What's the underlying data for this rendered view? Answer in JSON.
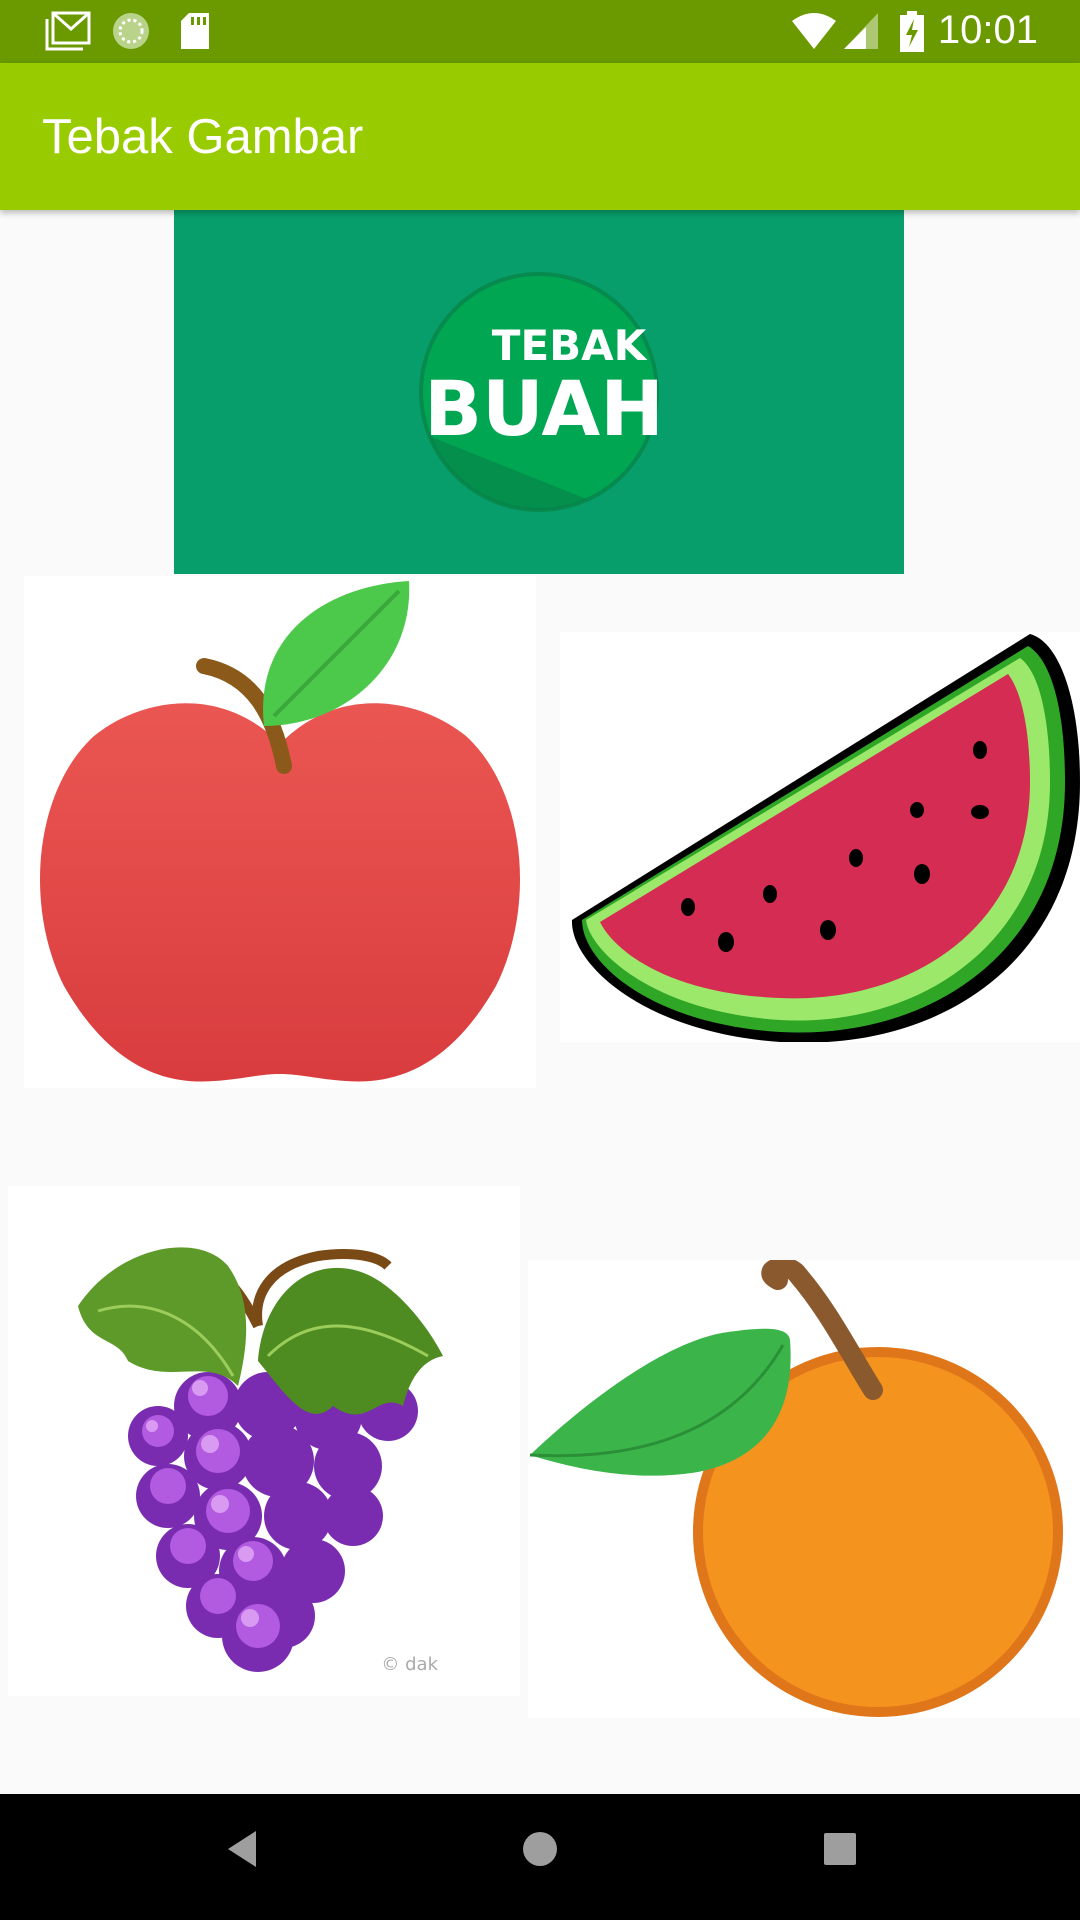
{
  "status_bar": {
    "time": "10:01",
    "icons": [
      "gmail-icon",
      "sync-icon",
      "sd-card-icon",
      "wifi-icon",
      "signal-icon",
      "battery-charging-icon"
    ]
  },
  "app_bar": {
    "title": "Tebak Gambar"
  },
  "banner": {
    "logo_text_top": "TEBAK",
    "logo_text_bottom": "BUAH",
    "background_color": "#089e6c"
  },
  "fruits": [
    {
      "name": "apple-image"
    },
    {
      "name": "watermelon-image"
    },
    {
      "name": "grapes-image",
      "watermark": "© dak"
    },
    {
      "name": "orange-image"
    }
  ],
  "nav_bar": {
    "buttons": [
      "back-icon",
      "home-icon",
      "recents-icon"
    ]
  },
  "colors": {
    "status_bar": "#6a9a00",
    "app_bar": "#99cc00",
    "page_bg": "#fafafa"
  }
}
